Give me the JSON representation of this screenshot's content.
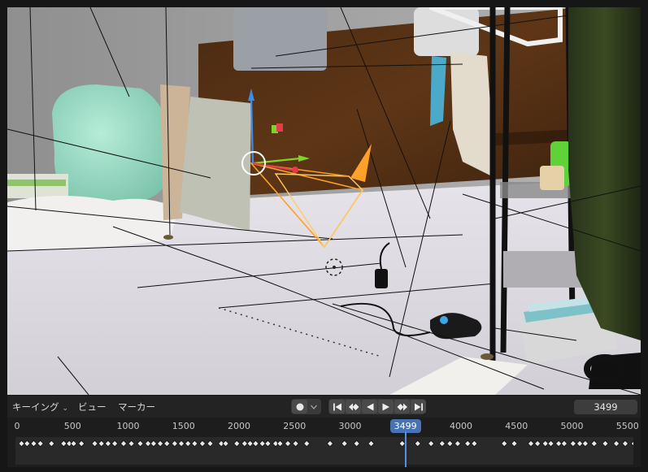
{
  "timeline": {
    "keying_menu_label": "キーイング",
    "view_menu_label": "ビュー",
    "marker_menu_label": "マーカー",
    "current_frame": "3499",
    "ruler_ticks": [
      "0",
      "500",
      "1000",
      "1500",
      "2000",
      "2500",
      "3000",
      "3499",
      "4000",
      "4500",
      "5000",
      "5500"
    ],
    "ruler_tick_values": [
      0,
      500,
      1000,
      1500,
      2000,
      2500,
      3000,
      3499,
      4000,
      4500,
      5000,
      5500
    ],
    "keyframe_frames": [
      40,
      90,
      150,
      210,
      310,
      420,
      470,
      510,
      580,
      700,
      760,
      820,
      880,
      960,
      1030,
      1110,
      1180,
      1230,
      1290,
      1350,
      1420,
      1480,
      1540,
      1600,
      1670,
      1740,
      1840,
      1880,
      1980,
      2050,
      2100,
      2150,
      2210,
      2260,
      2330,
      2370,
      2440,
      2510,
      2610,
      2820,
      2950,
      3060,
      3190,
      3470,
      3610,
      3730,
      3830,
      3900,
      3970,
      4060,
      4120,
      4390,
      4480,
      4630,
      4690,
      4760,
      4810,
      4880,
      4930,
      5010,
      5070,
      5120,
      5200,
      5300,
      5400,
      5480,
      5560
    ]
  },
  "icons": {
    "record": "record-circle",
    "jump_start": "jump-to-start",
    "prev_key": "previous-keyframe",
    "play_reverse": "play-reverse",
    "play": "play",
    "next_key": "next-keyframe",
    "jump_end": "jump-to-end"
  },
  "colors": {
    "accent": "#4772b3",
    "camera": "#ffa028",
    "axis_x": "#e83a4a",
    "axis_y": "#7cd42a",
    "axis_z": "#3a8cf0"
  }
}
